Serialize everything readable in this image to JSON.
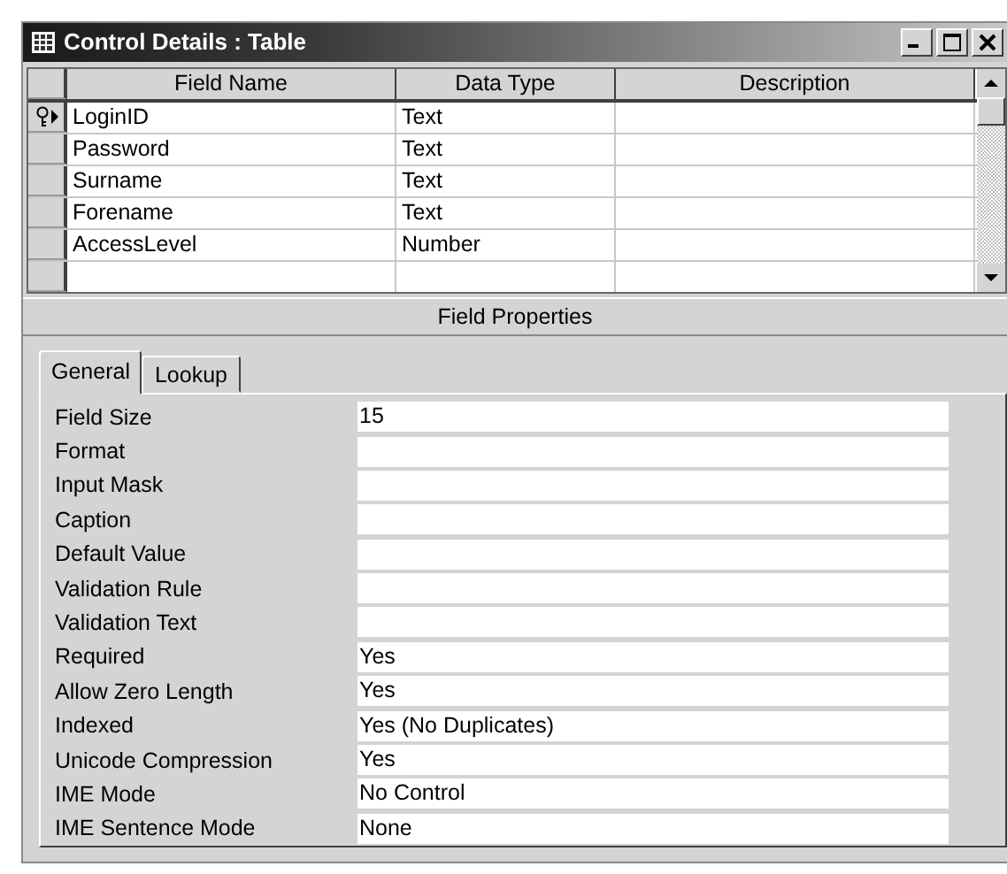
{
  "window": {
    "title": "Control Details : Table"
  },
  "grid": {
    "columns": [
      "Field Name",
      "Data Type",
      "Description"
    ],
    "rows": [
      {
        "field_name": "LoginID",
        "data_type": "Text",
        "primary_key": true,
        "current": true
      },
      {
        "field_name": "Password",
        "data_type": "Text",
        "primary_key": false,
        "current": false
      },
      {
        "field_name": "Surname",
        "data_type": "Text",
        "primary_key": false,
        "current": false
      },
      {
        "field_name": "Forename",
        "data_type": "Text",
        "primary_key": false,
        "current": false
      },
      {
        "field_name": "AccessLevel",
        "data_type": "Number",
        "primary_key": false,
        "current": false
      },
      {
        "primary_key": false,
        "current": false
      }
    ]
  },
  "field_properties": {
    "heading": "Field Properties",
    "tabs": [
      {
        "label": "General",
        "selected": true
      },
      {
        "label": "Lookup",
        "selected": false
      }
    ],
    "properties": [
      {
        "label": "Field Size",
        "value": "15"
      },
      {
        "label": "Format"
      },
      {
        "label": "Input Mask"
      },
      {
        "label": "Caption"
      },
      {
        "label": "Default Value"
      },
      {
        "label": "Validation Rule"
      },
      {
        "label": "Validation Text"
      },
      {
        "label": "Required",
        "value": "Yes"
      },
      {
        "label": "Allow Zero Length",
        "value": "Yes"
      },
      {
        "label": "Indexed",
        "value": "Yes (No Duplicates)"
      },
      {
        "label": "Unicode Compression",
        "value": "Yes"
      },
      {
        "label": "IME Mode",
        "value": "No Control"
      },
      {
        "label": "IME Sentence Mode",
        "value": "None"
      }
    ]
  }
}
